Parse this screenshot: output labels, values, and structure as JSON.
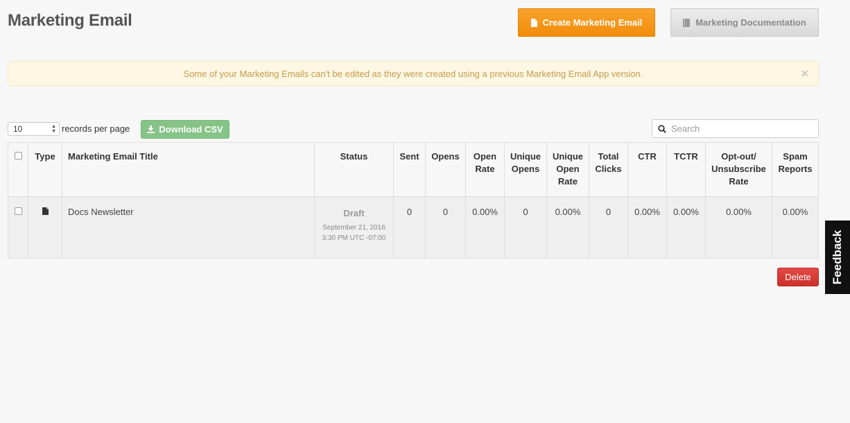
{
  "page": {
    "title": "Marketing Email"
  },
  "header": {
    "create_label": "Create Marketing Email",
    "docs_label": "Marketing Documentation"
  },
  "alert": {
    "message": "Some of your Marketing Emails can't be edited as they were created using a previous Marketing Email App version.",
    "close": "×"
  },
  "controls": {
    "per_page_value": "10",
    "per_page_label": "records per page",
    "download_label": "Download CSV",
    "search_placeholder": "Search"
  },
  "table": {
    "headers": {
      "type": "Type",
      "title": "Marketing Email Title",
      "status": "Status",
      "sent": "Sent",
      "opens": "Opens",
      "open_rate": "Open Rate",
      "unique_opens": "Unique Opens",
      "unique_open_rate": "Unique Open Rate",
      "total_clicks": "Total Clicks",
      "ctr": "CTR",
      "tctr": "TCTR",
      "optout": "Opt-out/ Unsubscribe Rate",
      "spam": "Spam Reports"
    },
    "rows": [
      {
        "title": "Docs Newsletter",
        "status": "Draft",
        "date": "September 21, 2016",
        "time": "3:30 PM UTC -07:00",
        "sent": "0",
        "opens": "0",
        "open_rate": "0.00%",
        "unique_opens": "0",
        "unique_open_rate": "0.00%",
        "total_clicks": "0",
        "ctr": "0.00%",
        "tctr": "0.00%",
        "optout": "0.00%",
        "spam": "0.00%"
      }
    ]
  },
  "actions": {
    "delete_label": "Delete"
  },
  "feedback": {
    "label": "Feedback"
  },
  "colors": {
    "create_button": "#f39214",
    "download_button": "#86c387",
    "delete_button": "#d63a35",
    "alert_bg": "#fdf7e3"
  }
}
